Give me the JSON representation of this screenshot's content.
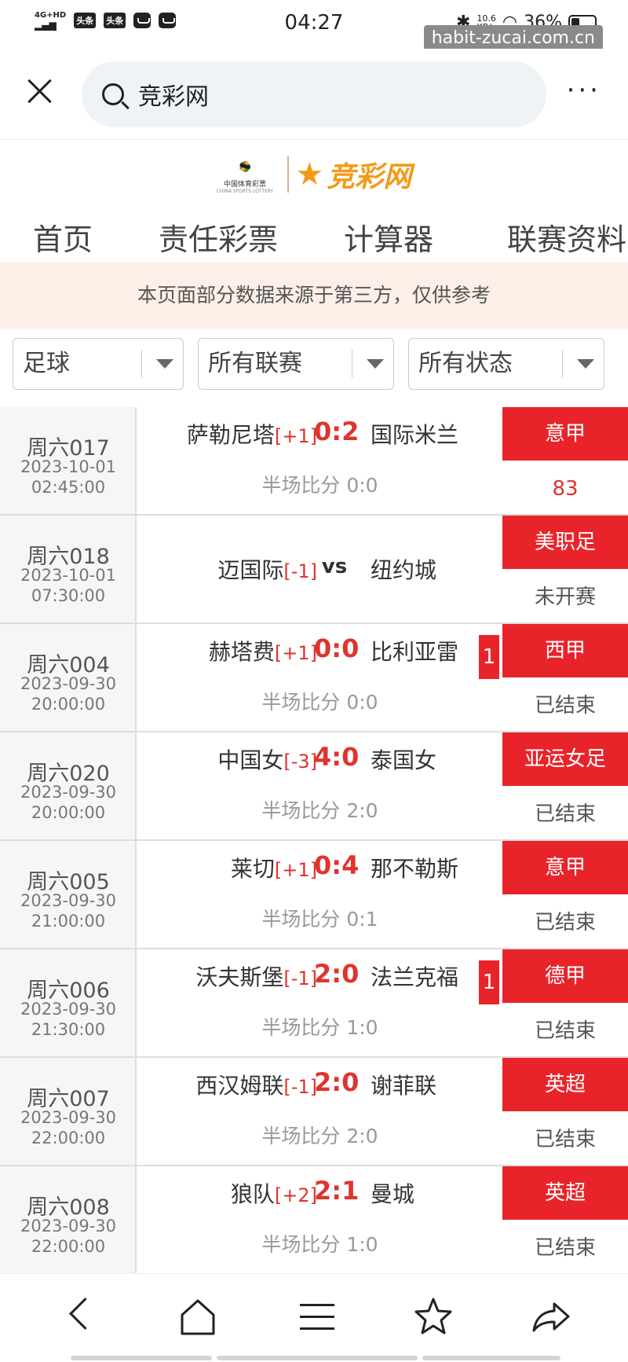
{
  "status_bar": {
    "network": "4G+HD",
    "app_badge_1": "头条",
    "app_badge_2": "头条",
    "time": "04:27",
    "speed": "10.6",
    "speed_unit": "KB/s",
    "battery": "36%"
  },
  "watermark": "habit-zucai.com.cn",
  "browser": {
    "search_text": "竞彩网"
  },
  "logo": {
    "lottery_cn": "中国体育彩票",
    "lottery_en": "CHINA SPORTS LOTTERY",
    "brand": "竞彩网"
  },
  "nav": {
    "items": [
      "首页",
      "责任彩票",
      "计算器",
      "联赛资料"
    ]
  },
  "notice": "本页面部分数据来源于第三方，仅供参考",
  "filters": {
    "sport": "足球",
    "league": "所有联赛",
    "state": "所有状态"
  },
  "matches": [
    {
      "code": "周六017",
      "date": "2023-10-01",
      "time": "02:45:00",
      "home": "萨勒尼塔",
      "handicap": "[+1]",
      "score": "0:2",
      "away": "国际米兰",
      "half": "半场比分 0:0",
      "league": "意甲",
      "status": "83"
    },
    {
      "code": "周六018",
      "date": "2023-10-01",
      "time": "07:30:00",
      "home": "迈国际",
      "handicap": "[-1]",
      "score": "vs",
      "away": "纽约城",
      "half": "",
      "league": "美职足",
      "status": "未开赛"
    },
    {
      "code": "周六004",
      "date": "2023-09-30",
      "time": "20:00:00",
      "home": "赫塔费",
      "handicap": "[+1]",
      "score": "0:0",
      "away": "比利亚雷",
      "half": "半场比分 0:0",
      "league": "西甲",
      "status": "已结束",
      "redcard": "1"
    },
    {
      "code": "周六020",
      "date": "2023-09-30",
      "time": "20:00:00",
      "home": "中国女",
      "handicap": "[-3]",
      "score": "4:0",
      "away": "泰国女",
      "half": "半场比分 2:0",
      "league": "亚运女足",
      "status": "已结束"
    },
    {
      "code": "周六005",
      "date": "2023-09-30",
      "time": "21:00:00",
      "home": "莱切",
      "handicap": "[+1]",
      "score": "0:4",
      "away": "那不勒斯",
      "half": "半场比分 0:1",
      "league": "意甲",
      "status": "已结束"
    },
    {
      "code": "周六006",
      "date": "2023-09-30",
      "time": "21:30:00",
      "home": "沃夫斯堡",
      "handicap": "[-1]",
      "score": "2:0",
      "away": "法兰克福",
      "half": "半场比分 1:0",
      "league": "德甲",
      "status": "已结束",
      "redcard": "1"
    },
    {
      "code": "周六007",
      "date": "2023-09-30",
      "time": "22:00:00",
      "home": "西汉姆联",
      "handicap": "[-1]",
      "score": "2:0",
      "away": "谢菲联",
      "half": "半场比分 2:0",
      "league": "英超",
      "status": "已结束"
    },
    {
      "code": "周六008",
      "date": "2023-09-30",
      "time": "22:00:00",
      "home": "狼队",
      "handicap": "[+2]",
      "score": "2:1",
      "away": "曼城",
      "half": "半场比分 1:0",
      "league": "英超",
      "status": "已结束"
    }
  ],
  "colors": {
    "accent_red": "#e8242a",
    "score_red": "#e0332e",
    "brand_orange": "#f29a1a",
    "notice_bg": "#fcefe8"
  }
}
